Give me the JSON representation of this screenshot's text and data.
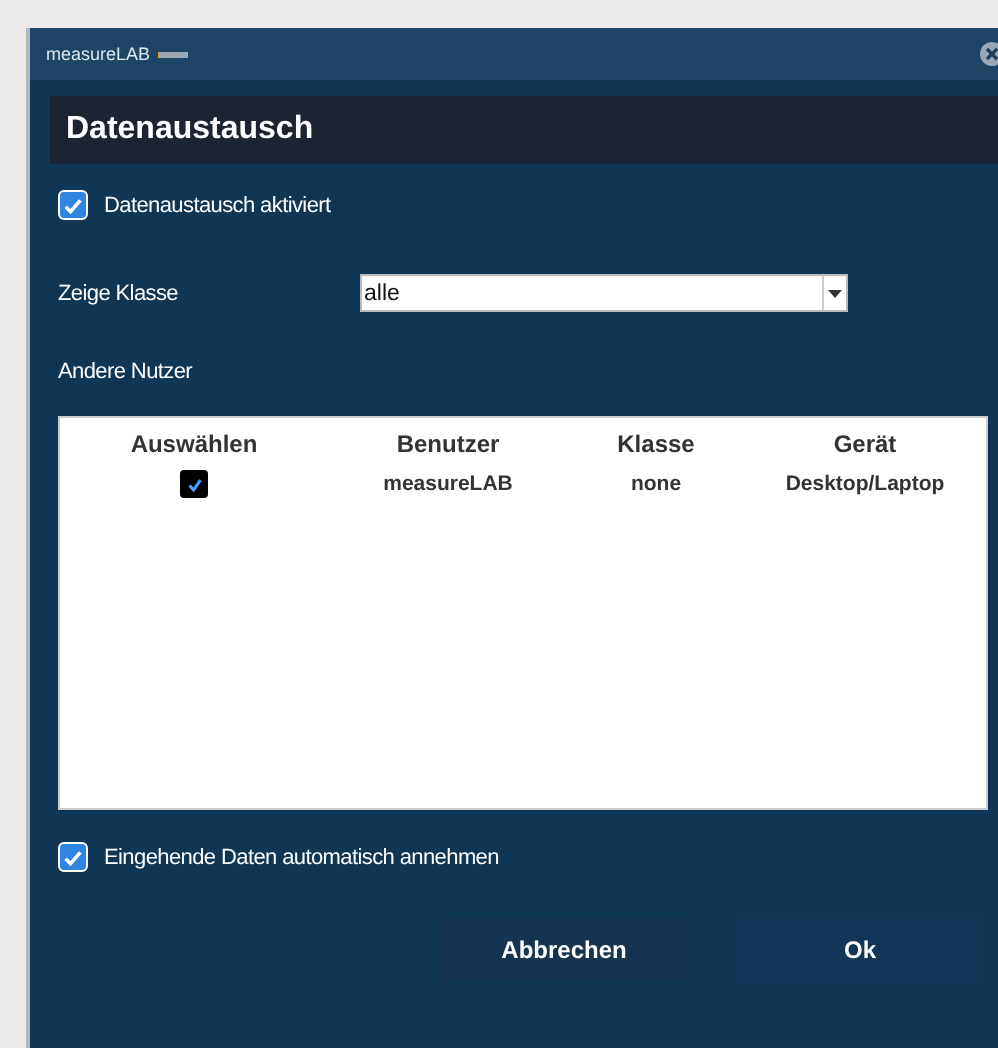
{
  "window": {
    "app_name": "measureLAB"
  },
  "heading": "Datenaustausch",
  "exchange_enabled": {
    "label": "Datenaustausch aktiviert",
    "checked": true
  },
  "class_filter": {
    "label": "Zeige Klasse",
    "value": "alle"
  },
  "users_label": "Andere Nutzer",
  "table": {
    "columns": [
      "Auswählen",
      "Benutzer",
      "Klasse",
      "Gerät"
    ],
    "rows": [
      {
        "checked": true,
        "user": "measureLAB",
        "class": "none",
        "device": "Desktop/Laptop"
      }
    ]
  },
  "auto_accept": {
    "label": "Eingehende Daten automatisch annehmen",
    "checked": true
  },
  "buttons": [
    "Abbrechen",
    "Ok"
  ]
}
